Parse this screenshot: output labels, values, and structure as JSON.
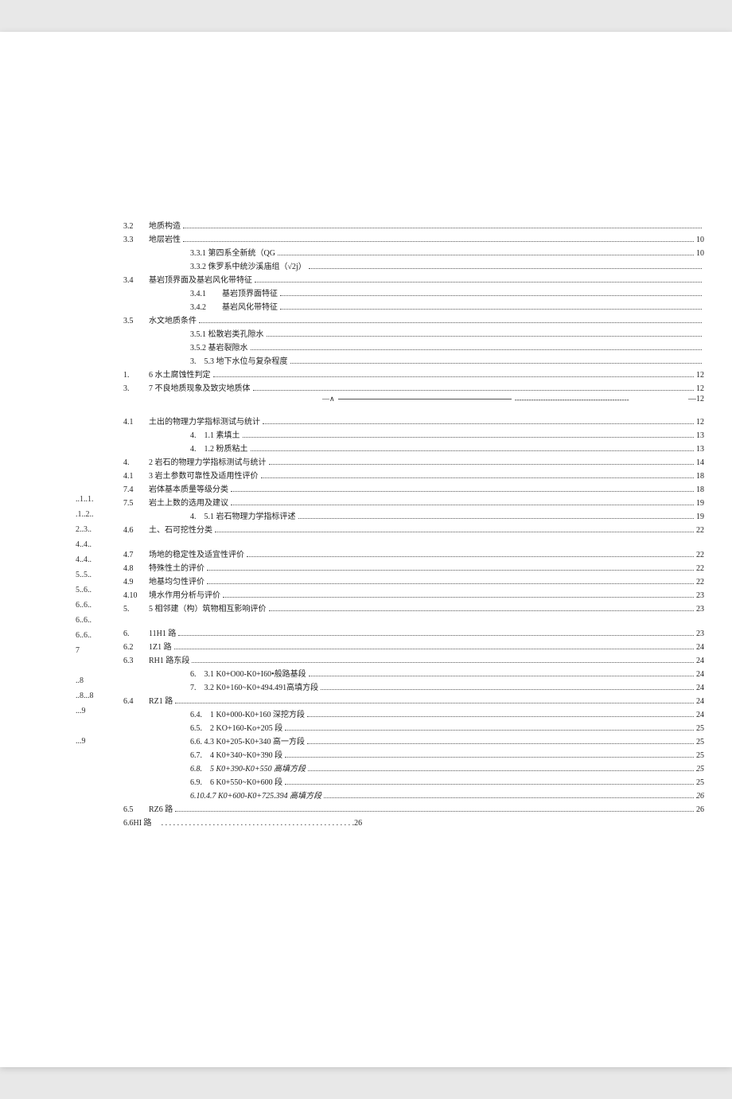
{
  "leftMargin": [
    "..1..1.",
    ".1..2..",
    "2..3..",
    "4..4..",
    "4..4..",
    "5..5..",
    "5..6..",
    "6..6..",
    "6..6..",
    "6..6..",
    "7",
    "",
    "..8",
    "..8...8",
    "...9",
    "",
    "...9"
  ],
  "rows": [
    {
      "num": "3.2",
      "title": "地质构造",
      "page": "",
      "indent": 1
    },
    {
      "num": "3.3",
      "title": "地层岩性",
      "page": "10",
      "indent": 1
    },
    {
      "num": "",
      "title": "3.3.1 第四系全新统（QG",
      "page": "10",
      "indent": 2
    },
    {
      "num": "",
      "title": "3.3.2 侏罗系中统沙溪庙组（√2j）",
      "page": "",
      "indent": 2
    },
    {
      "num": "3.4",
      "title": "基岩顶界面及基岩风化带特征",
      "page": "",
      "indent": 1
    },
    {
      "num": "",
      "title": "3.4.1　　基岩顶界面特征",
      "page": "",
      "indent": 2
    },
    {
      "num": "",
      "title": "3.4.2　　基岩风化带特征",
      "page": "",
      "indent": 2
    },
    {
      "num": "3.5",
      "title": "水文地质条件",
      "page": "",
      "indent": 1
    },
    {
      "num": "",
      "title": "3.5.1 松散岩类孔隙水",
      "page": "",
      "indent": 2
    },
    {
      "num": "",
      "title": "3.5.2 基岩裂隙水",
      "page": "",
      "indent": 2
    },
    {
      "num": "",
      "title": "3.　5.3 地下水位与复杂程度",
      "page": "",
      "indent": 2
    },
    {
      "num": "1.",
      "title": "6 水土腐蚀性判定",
      "page": "12",
      "indent": 1
    },
    {
      "num": "3.",
      "title": "7 不良地质现象及致灾地质体",
      "page": "12",
      "indent": 1
    },
    {
      "type": "special",
      "page": "12"
    },
    {
      "type": "gap"
    },
    {
      "num": "4.1",
      "title": "土出的物理力学指标测试与统计",
      "page": "12",
      "indent": 1
    },
    {
      "num": "",
      "title": "4.　1.1 素填土",
      "page": "13",
      "indent": 2
    },
    {
      "num": "",
      "title": "4.　1.2 粉质粘土",
      "page": "13",
      "indent": 2
    },
    {
      "num": "4.",
      "title": "2 岩石的物理力学指标测试与统计",
      "page": "14",
      "indent": 1
    },
    {
      "num": "4.1",
      "title": "3 岩土参数可靠性及适用性评价",
      "page": "18",
      "indent": 1
    },
    {
      "num": "7.4",
      "title": "岩体基本质量等级分类",
      "page": "18",
      "indent": 1
    },
    {
      "num": "7.5",
      "title": "岩土上数的选用及建议",
      "page": "19",
      "indent": 1
    },
    {
      "num": "",
      "title": "4.　5.1 岩石物理力学指标评述",
      "page": "19",
      "indent": 2
    },
    {
      "num": "4.6",
      "title": "土、石可挖性分类",
      "page": "22",
      "indent": 1
    },
    {
      "type": "gap-lg"
    },
    {
      "num": "4.7",
      "title": "场地的稳定性及适宜性评价",
      "page": "22",
      "indent": 1
    },
    {
      "num": "4.8",
      "title": "特殊性土的评价",
      "page": "22",
      "indent": 1
    },
    {
      "num": "4.9",
      "title": "地基均匀性评价",
      "page": "22",
      "indent": 1
    },
    {
      "num": "4.10",
      "title": "境水作用分析与评价",
      "page": "23",
      "indent": 1
    },
    {
      "num": "5.",
      "title": "5 相邻建（构）筑物相互影响评价",
      "page": "23",
      "indent": 1
    },
    {
      "type": "gap-lg"
    },
    {
      "num": "6.",
      "title": "11H1 路",
      "page": "23",
      "indent": 1
    },
    {
      "num": "6.2",
      "title": "1Z1 路",
      "page": "24",
      "indent": 1
    },
    {
      "num": "6.3",
      "title": "RH1 路东段",
      "page": "24",
      "indent": 1
    },
    {
      "num": "",
      "title": "6.　3.1  K0+O00-K0+I60•般路基段",
      "page": "24",
      "indent": 2
    },
    {
      "num": "",
      "title": "7.　3.2  K0+160~K0+494.491高填方段",
      "page": "24",
      "indent": 2
    },
    {
      "num": "6.4",
      "title": "RZ1 路",
      "page": "24",
      "indent": 1
    },
    {
      "num": "",
      "title": "6.4.　1 K0+000-K0+160 深挖方段",
      "page": "24",
      "indent": 2
    },
    {
      "num": "",
      "title": "6.5.　2 KO+160-Ko+205 段",
      "page": "25",
      "indent": 2
    },
    {
      "num": "",
      "title": "6.6. 4.3  K0+205-K0+340 高一方段",
      "page": "25",
      "indent": 2
    },
    {
      "num": "",
      "title": "6.7.　4 K0+340~K0+390 段",
      "page": "25",
      "indent": 2
    },
    {
      "num": "",
      "title": "6.8.　5 K0+390-K0+550 高填方段",
      "page": "25",
      "indent": 2,
      "italic": true
    },
    {
      "num": "",
      "title": "6.9.　6 K0+550~K0+600 段",
      "page": "25",
      "indent": 2
    },
    {
      "num": "",
      "title": "6.10.4.7  K0+600-K0+725.394 高填方段",
      "page": "26",
      "indent": 2,
      "italic": true
    },
    {
      "num": "6.5",
      "title": "RZ6 路",
      "page": "26",
      "indent": 1
    },
    {
      "num": "6.6HI 路",
      "title": "",
      "page": "26",
      "nodots": true,
      "indent": 1
    }
  ]
}
